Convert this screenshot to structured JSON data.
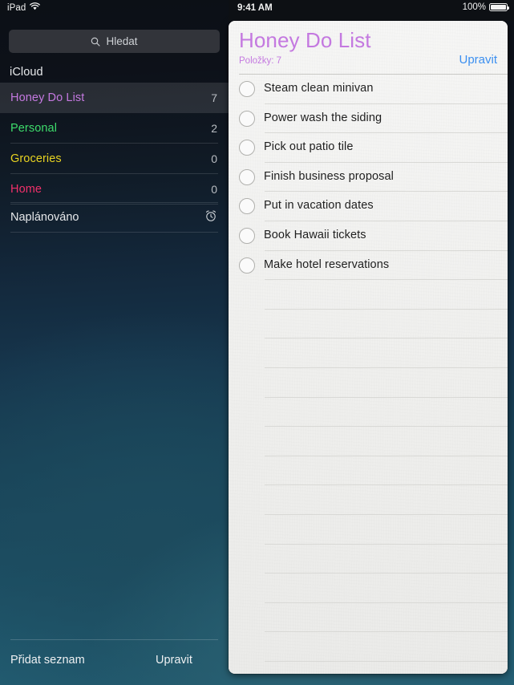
{
  "status_bar": {
    "device_label": "iPad",
    "wifi_icon": "wifi-icon",
    "time": "9:41 AM",
    "battery_percent": "100%",
    "battery_icon": "battery-full-icon"
  },
  "sidebar": {
    "search": {
      "placeholder": "Hledat",
      "icon": "search-icon"
    },
    "account_header": "iCloud",
    "lists": [
      {
        "name": "Honey Do List",
        "count": "7",
        "color": "#c479e0",
        "selected": true
      },
      {
        "name": "Personal",
        "count": "2",
        "color": "#3ddc6b",
        "selected": false
      },
      {
        "name": "Groceries",
        "count": "0",
        "color": "#e8d321",
        "selected": false
      },
      {
        "name": "Home",
        "count": "0",
        "color": "#f0306a",
        "selected": false
      }
    ],
    "scheduled": {
      "label": "Naplánováno",
      "icon": "alarm-clock-icon"
    },
    "toolbar": {
      "add_list_label": "Přidat seznam",
      "edit_label": "Upravit"
    }
  },
  "detail": {
    "title": "Honey Do List",
    "title_color": "#c479e0",
    "subtitle": "Položky: 7",
    "subtitle_color": "#c479e0",
    "edit_label": "Upravit",
    "edit_color": "#3b8ff0",
    "reminders": [
      {
        "text": "Steam clean minivan",
        "completed": false
      },
      {
        "text": "Power wash the siding",
        "completed": false
      },
      {
        "text": "Pick out patio tile",
        "completed": false
      },
      {
        "text": "Finish business proposal",
        "completed": false
      },
      {
        "text": "Put in vacation dates",
        "completed": false
      },
      {
        "text": "Book Hawaii tickets",
        "completed": false
      },
      {
        "text": "Make hotel reservations",
        "completed": false
      }
    ]
  }
}
